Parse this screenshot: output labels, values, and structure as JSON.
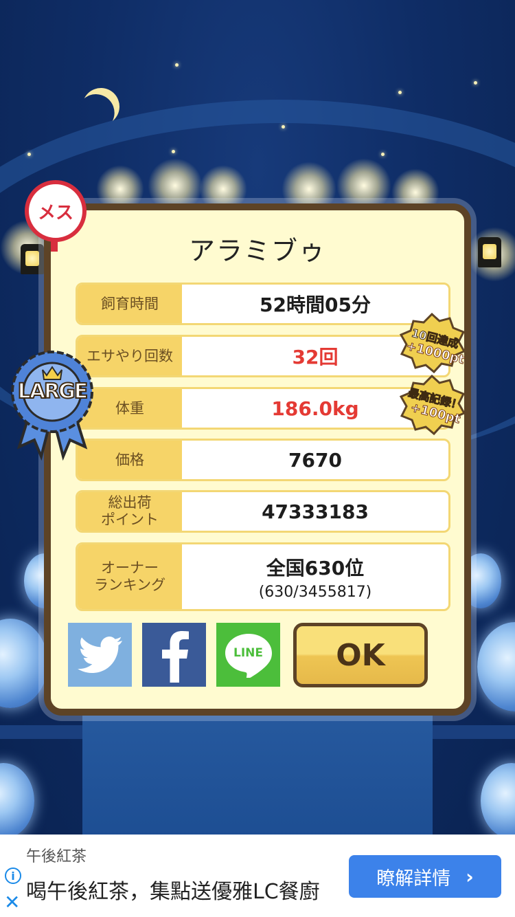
{
  "panel": {
    "title": "アラミブゥ",
    "rows": [
      {
        "label": "飼育時間",
        "value": "52時間05分"
      },
      {
        "label": "エサやり回数",
        "value": "32回"
      },
      {
        "label": "体重",
        "value": "186.0kg"
      },
      {
        "label": "価格",
        "value": "7670"
      },
      {
        "label_line1": "総出荷",
        "label_line2": "ポイント",
        "value": "47333183"
      },
      {
        "label_line1": "オーナー",
        "label_line2": "ランキング",
        "value": "全国630位",
        "sub": "(630/3455817)"
      }
    ],
    "ok_label": "OK"
  },
  "badges": {
    "gender": "メス",
    "size": "LARGE",
    "seal1_line1": "10回達成",
    "seal1_line2": "+1000pt",
    "seal2_line1": "最高記録！",
    "seal2_line2": "+100pt"
  },
  "share": {
    "twitter_icon": "twitter-icon",
    "facebook_icon": "facebook-icon",
    "line_label": "LINE"
  },
  "ad": {
    "sponsor": "午後紅茶",
    "text": "喝午後紅茶，集點送優雅LC餐廚",
    "button_label": "瞭解詳情",
    "info_icon": "i",
    "close_icon": "✕",
    "chevron": "›"
  },
  "colors": {
    "panel_bg": "#fffbd0",
    "panel_border": "#5d4326",
    "label_bg": "#f6d468",
    "highlight_red": "#e43a34",
    "ad_button": "#3c82ea"
  }
}
